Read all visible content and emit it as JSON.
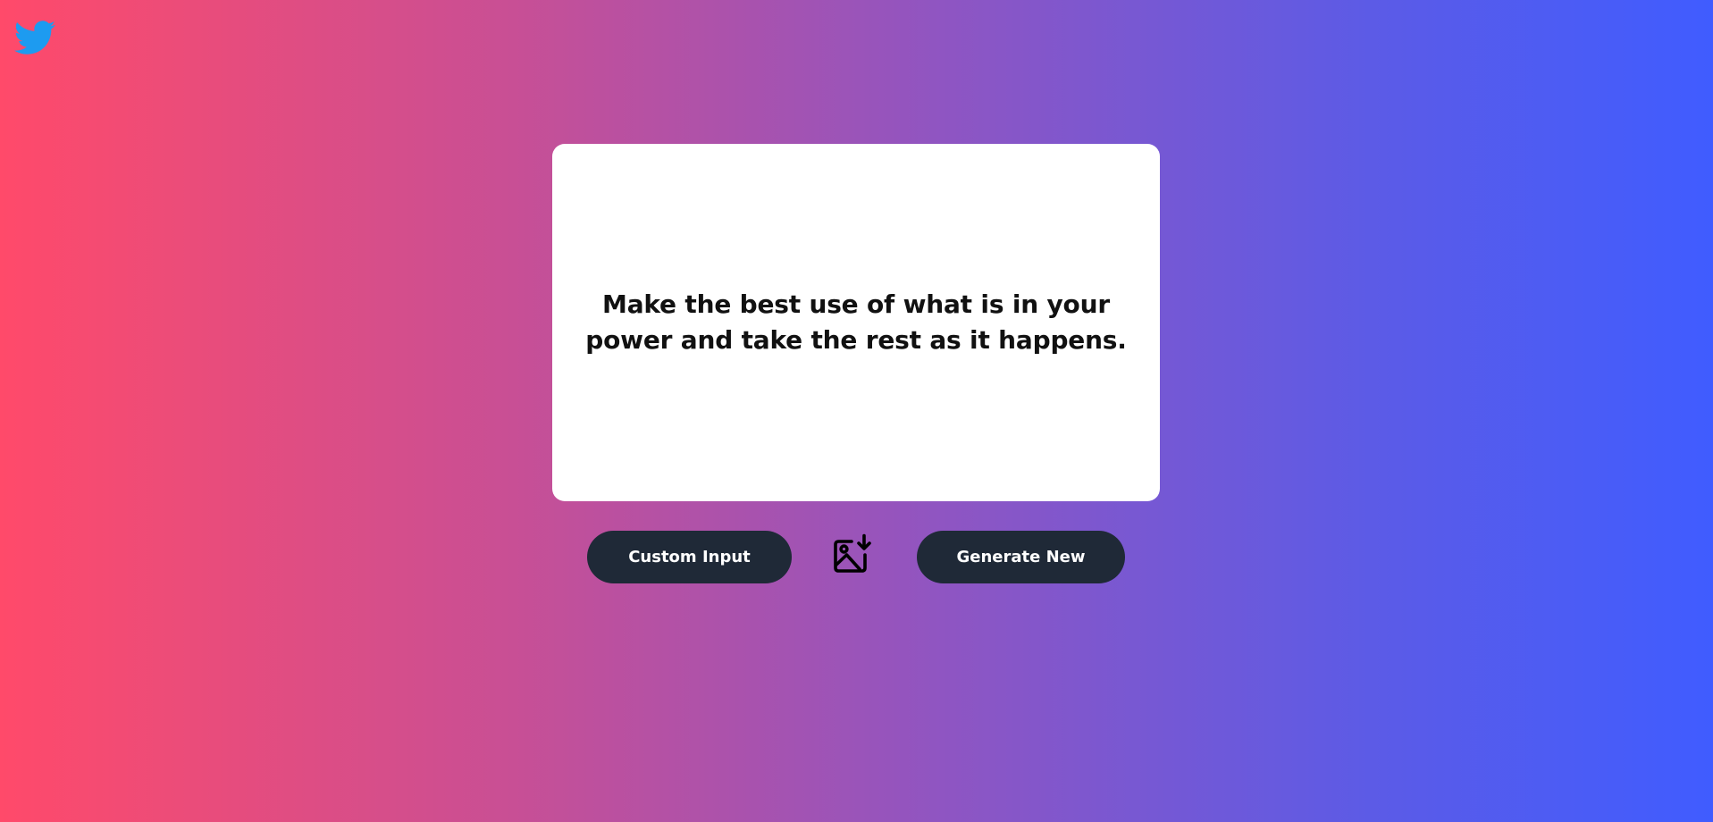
{
  "header": {
    "twitter_icon": "twitter-bird-icon",
    "twitter_color": "#1d9bf0"
  },
  "quote": {
    "text": "Make the best use of what is in your power and take the rest as it happens."
  },
  "controls": {
    "custom_input_label": "Custom Input",
    "download_icon": "image-download-icon",
    "generate_label": "Generate New"
  },
  "colors": {
    "gradient_start": "#ff4a6a",
    "gradient_end": "#405cff",
    "button_bg": "#1f2937",
    "card_bg": "#ffffff"
  }
}
